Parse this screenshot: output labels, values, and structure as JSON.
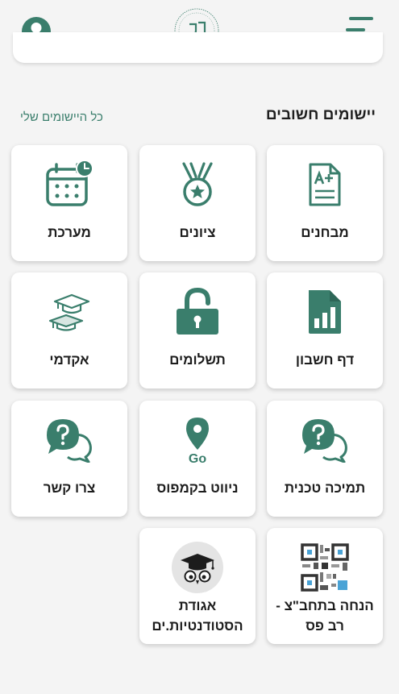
{
  "header": {
    "profile_icon": "user-circle-icon",
    "logo_icon": "college-logo",
    "menu_icon": "hamburger-menu-icon"
  },
  "section": {
    "title": "יישומים חשובים",
    "all_apps_link": "כל היישומים שלי"
  },
  "apps": [
    {
      "label": "מבחנים",
      "icon": "exam-document-icon"
    },
    {
      "label": "ציונים",
      "icon": "medal-icon"
    },
    {
      "label": "מערכת",
      "icon": "calendar-clock-icon"
    },
    {
      "label": "דף חשבון",
      "icon": "spreadsheet-chart-icon"
    },
    {
      "label": "תשלומים",
      "icon": "unlocked-padlock-icon"
    },
    {
      "label": "אקדמי",
      "icon": "graduation-caps-icon"
    },
    {
      "label": "תמיכה טכנית",
      "icon": "question-chat-icon"
    },
    {
      "label": "ניווט בקמפוס",
      "icon": "map-pin-go-icon"
    },
    {
      "label": "צרו קשר",
      "icon": "question-chat-icon"
    },
    {
      "label": "הנחה בתחב\"צ - רב פס",
      "icon": "qr-code-icon"
    },
    {
      "label": "אגודת הסטודנטיות.ים",
      "icon": "owl-graduate-icon"
    }
  ],
  "colors": {
    "accent": "#3a7e6c",
    "background": "#f4f4f4",
    "card": "#ffffff"
  }
}
